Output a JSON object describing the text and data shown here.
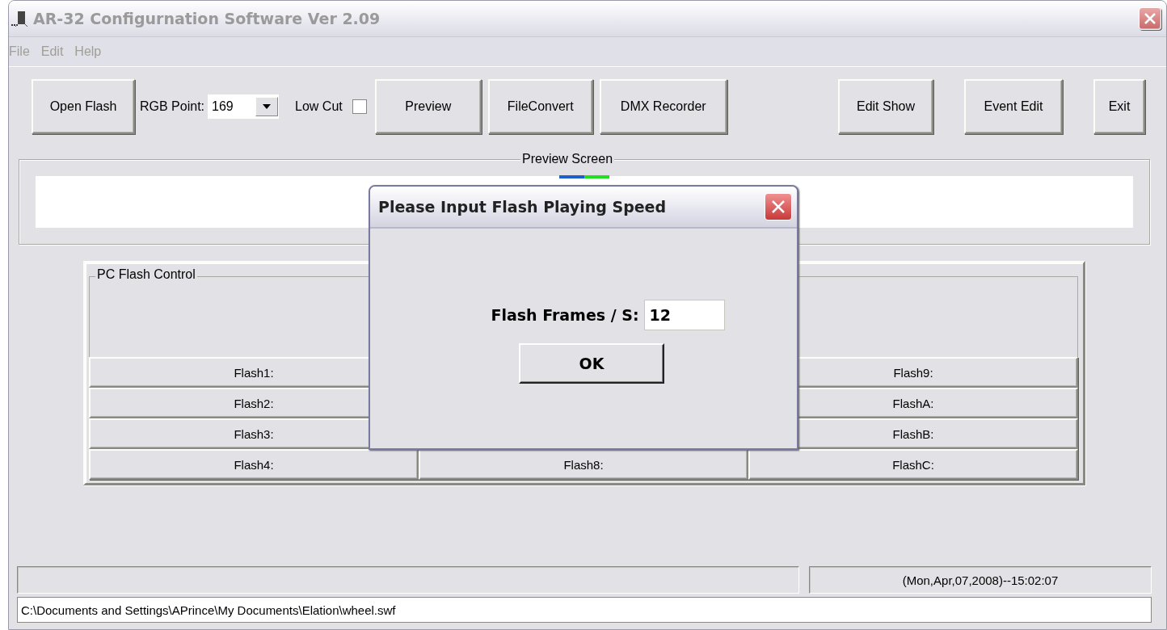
{
  "window": {
    "title": "AR-32 Configurnation Software Ver 2.09"
  },
  "menu": [
    "File",
    "Edit",
    "Help"
  ],
  "toolbar": {
    "open_flash": "Open Flash",
    "rgb_point_label": "RGB Point:",
    "rgb_point_value": "169",
    "low_cut_label": "Low Cut",
    "low_cut_checked": false,
    "buttons_left": [
      "Preview",
      "FileConvert",
      "DMX Recorder"
    ],
    "buttons_right": [
      "Edit Show",
      "Event Edit",
      "Exit"
    ]
  },
  "preview_screen": {
    "title": "Preview Screen"
  },
  "flash_control": {
    "title": "PC Flash Control",
    "columns": [
      [
        "Flash1:",
        "Flash2:",
        "Flash3:",
        "Flash4:"
      ],
      [
        null,
        null,
        null,
        "Flash8:"
      ],
      [
        "Flash9:",
        "FlashA:",
        "FlashB:",
        "FlashC:"
      ]
    ]
  },
  "dialog": {
    "title": "Please Input Flash Playing Speed",
    "field_label": "Flash Frames / S:",
    "field_value": "12",
    "ok": "OK"
  },
  "status_bar": {
    "datetime": "(Mon,Apr,07,2008)--15:02:07",
    "path": "C:\\Documents and Settings\\APrince\\My Documents\\Elation\\wheel.swf"
  }
}
